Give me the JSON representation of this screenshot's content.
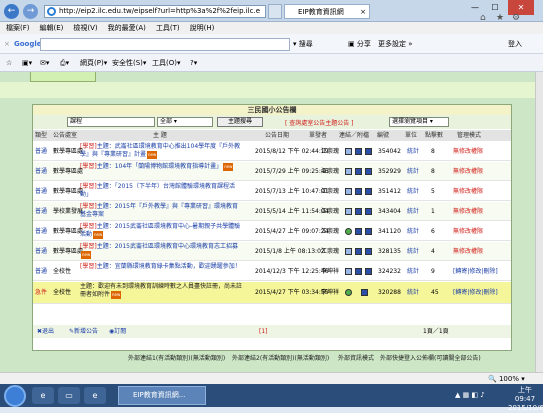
{
  "browser": {
    "url": "http://eip2.ilc.edu.tw/eipself?url=http%3a%2f%2feip.ilc.e",
    "tabs": [
      {
        "label": "EIP教育資訊網"
      }
    ],
    "window_buttons": {
      "min": "—",
      "max": "☐",
      "close": "✕"
    }
  },
  "menu": [
    "檔案(F)",
    "編輯(E)",
    "檢視(V)",
    "我的最愛(A)",
    "工具(T)",
    "說明(H)"
  ],
  "google": {
    "label": "Google",
    "search_label": "搜尋",
    "share_label": "分享",
    "more_label": "更多設定 »",
    "login_label": "登入"
  },
  "favbar": {
    "page": "網頁(P)",
    "safety": "安全性(S)",
    "tools": "工具(O)"
  },
  "panel": {
    "title": "三民國小公告欄",
    "search_value": "課程",
    "scope_value": "全部",
    "search_button": "主題搜尋",
    "unit_notice": "[ 查詢處室公告主題公告 ]",
    "choose": "選擇瀏覽項目"
  },
  "columns": [
    "類型",
    "公告處室",
    "主 題",
    "公告日期",
    "單發者",
    "連結／附檔",
    "編號",
    "單位",
    "點擊數",
    "管理模式"
  ],
  "rows": [
    {
      "type": "普通",
      "dept": "數學專區處",
      "tag": "[學習]",
      "title": "主題：武崙社區環境教育中心推出104學年度『戶外教學』與『專業研習』計畫",
      "new": true,
      "date": "2015/8/12 下午 02:44:19",
      "author": "江崇瑰",
      "id": "354042",
      "stat": "統計",
      "clicks": "8",
      "manage": "無修改權限"
    },
    {
      "type": "普通",
      "dept": "數學專區處",
      "tag": "[學習]",
      "title": "主題：104年「蘭陽博物館環境教育指導計畫」",
      "new": true,
      "date": "2015/7/29 上午 09:25:46",
      "author": "江崇瑰",
      "id": "352929",
      "stat": "統計",
      "clicks": "8",
      "manage": "無修改權限"
    },
    {
      "type": "普通",
      "dept": "數學專區處",
      "tag": "[學習]",
      "title": "主題：「2015（下半年）台灣館體驗環境教育課程活動」",
      "new": false,
      "date": "2015/7/13 上午 10:47:01",
      "author": "江崇瑰",
      "id": "351412",
      "stat": "統計",
      "clicks": "5",
      "manage": "無修改權限"
    },
    {
      "type": "普通",
      "dept": "學校業發展",
      "tag": "[學習]",
      "title": "主題：2015年『戶外教學』與『專業研習』環境教育基金專案",
      "new": false,
      "date": "2015/5/14 上午 11:54:04",
      "author": "江崇瑰",
      "id": "343404",
      "stat": "統計",
      "clicks": "1",
      "manage": "無修改權限"
    },
    {
      "type": "普通",
      "dept": "數學專區處",
      "tag": "[學習]",
      "title": "主題：2015武崙社區環境教育中心-暑期親子共學體驗活動",
      "new": true,
      "date": "2015/4/27 上午 09:07:24",
      "author": "江崇瑰",
      "id": "341120",
      "stat": "統計",
      "clicks": "6",
      "manage": "無修改權限"
    },
    {
      "type": "普通",
      "dept": "數學專區處",
      "tag": "[學習]",
      "title": "主題：2015武崙社區環境教育中心環境教育志工招募",
      "new": true,
      "date": "2015/1/8 上午 08:13:02",
      "author": "江崇瑰",
      "id": "328135",
      "stat": "統計",
      "clicks": "4",
      "manage": "無修改權限"
    },
    {
      "type": "普通",
      "dept": "全校性",
      "tag": "[學習]",
      "title": "主題：宜蘭縣環境教育綠卡集點活動，歡迎踴躍參加！",
      "new": false,
      "date": "2014/12/3 下午 12:25:46",
      "author": "李坤祥",
      "id": "324232",
      "stat": "統計",
      "clicks": "9",
      "manage": "[轉寄|修改|刪除]"
    },
    {
      "type": "急件",
      "dept": "全校性",
      "tag": "",
      "title": "主題：歡迎有未到環境教育訓練時數之人員盡快註冊，尚未註冊者如附件",
      "new": true,
      "date": "2015/4/27 下午 03:34:55",
      "author": "李坤祥",
      "id": "320288",
      "stat": "統計",
      "clicks": "45",
      "manage": "[轉寄|修改|刪除]"
    }
  ],
  "footer": {
    "back": "退出",
    "add": "新增公告",
    "rss": "訂閱",
    "page_marker": "[1]",
    "pages": "1頁／1頁"
  },
  "bottom_links": [
    "外部連結1(有活動類別)(無活動類別)",
    "外部連結2(有活動類別)(無活動類別)",
    "外部資訊模式",
    "外部快捷登入公佈欄(可讀關全部公告)"
  ],
  "status": {
    "zoom": "100%"
  },
  "taskbar": {
    "ie_title": "EIP教育資訊網...",
    "time": "上午 09:47",
    "date": "2015/10/6"
  }
}
